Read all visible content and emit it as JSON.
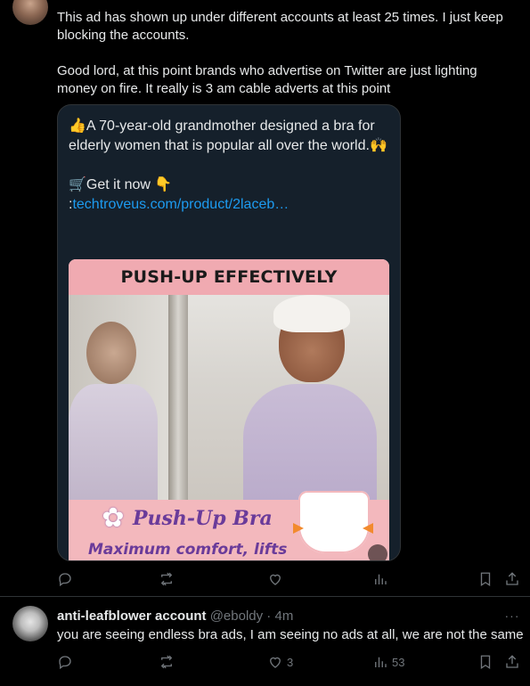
{
  "tweet": {
    "text": "This ad has shown up under different accounts at least 25 times. I just keep blocking the accounts.\n\nGood lord, at this point brands who advertise on Twitter are just lighting money on fire. It really is 3 am cable adverts at this point",
    "quoted_ad": {
      "line1": "👍A 70-year-old grandmother designed a bra for elderly women that is popular all over the world.🙌",
      "cta_prefix": "🛒Get it now 👇 :",
      "link": "techtroveus.com/product/2laceb…",
      "image": {
        "banner": "PUSH-UP EFFECTIVELY",
        "title": "Push-Up Bra",
        "subtitle": "Maximum comfort, lifts"
      }
    },
    "actions": {
      "reply_icon": "reply-icon",
      "retweet_icon": "retweet-icon",
      "like_icon": "heart-icon",
      "views_icon": "views-icon",
      "bookmark_icon": "bookmark-icon",
      "share_icon": "share-icon"
    }
  },
  "reply": {
    "name": "anti-leafblower account",
    "handle": "@eboldy",
    "time": "4m",
    "separator": " · ",
    "text": "you are seeing endless bra ads, I am seeing no ads at all, we are not the same",
    "likes": "3",
    "views": "53",
    "more_icon": "···"
  },
  "colors": {
    "background": "#000000",
    "text": "#e7e9ea",
    "muted": "#71767b",
    "link": "#1d9bf0",
    "divider": "#2f3336"
  }
}
